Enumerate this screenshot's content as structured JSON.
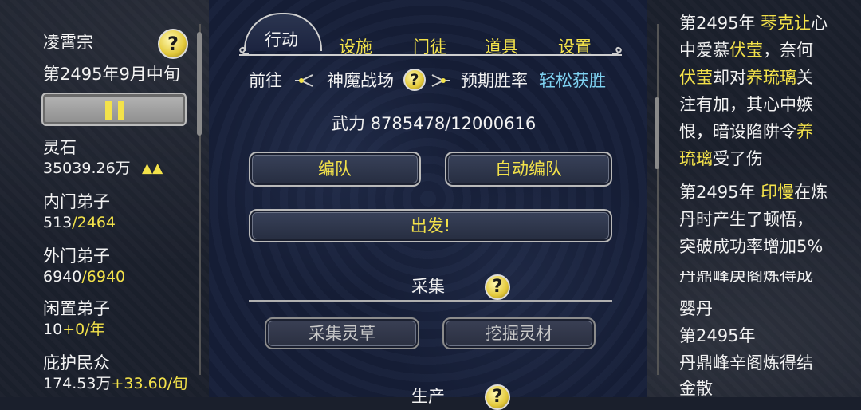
{
  "left": {
    "sect_name": "凌霄宗",
    "date": "第2495年9月中旬",
    "help_symbol": "?",
    "spirit_stone_label": "灵石",
    "spirit_stone_value": "35039.26万",
    "spirit_stone_trend": "▲▲",
    "inner_label": "内门弟子",
    "inner_current": "513",
    "inner_max": "/2464",
    "outer_label": "外门弟子",
    "outer_current": "6940",
    "outer_max": "/6940",
    "idle_label": "闲置弟子",
    "idle_value": "10",
    "idle_rate": "+0/年",
    "people_label": "庇护民众",
    "people_value": "174.53万",
    "people_rate": "+33.60/旬"
  },
  "tabs": [
    "行动",
    "设施",
    "门徒",
    "道具",
    "设置"
  ],
  "center": {
    "goto_label": "前往",
    "destination": "神魔战场",
    "help_symbol": "?",
    "win_label": "预期胜率",
    "win_value": "轻松获胜",
    "power_label": "武力",
    "power_value": "8785478/12000616",
    "formation_btn": "编队",
    "auto_formation_btn": "自动编队",
    "depart_btn": "出发!",
    "gather_title": "采集",
    "gather_herb_btn": "采集灵草",
    "dig_material_btn": "挖掘灵材",
    "produce_title_partial": "生产"
  },
  "log": {
    "e1_prefix": "第2495年 ",
    "e1_name": "琴克让",
    "e1_line1_rest": "心",
    "e1_line2_a": "中爱慕",
    "e1_name2": "伏莹",
    "e1_line2_b": "，奈何",
    "e1_name3": "伏莹",
    "e1_line3": "却对",
    "e1_name4": "养琉璃",
    "e1_line3_b": "关",
    "e1_line4": "注有加，其心中嫉",
    "e1_line5_a": "恨，暗设陷阱令",
    "e1_name5": "养",
    "e1_name5b": "琉璃",
    "e1_line6": "受了伤",
    "e2_prefix": "第2495年 ",
    "e2_name": "印慢",
    "e2_line1_rest": "在炼",
    "e2_line2": "丹时产生了顿悟，",
    "e2_line3": "突破成功率增加5%",
    "e3_cut": "丹鼎峰庚阁炼得成",
    "e3_line2": "婴丹",
    "e4_line1": "第2495年",
    "e4_line2": "丹鼎峰辛阁炼得结",
    "e4_line3": "金散"
  }
}
